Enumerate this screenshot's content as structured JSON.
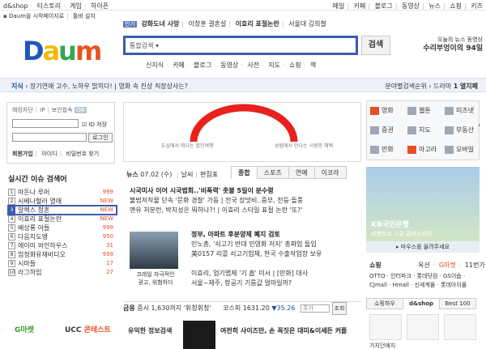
{
  "topbar": {
    "left": [
      "d&shop",
      "티스토리",
      "게임",
      "하이픈"
    ],
    "right": [
      "메일",
      "카페",
      "블로그",
      "동영상",
      "뉴스",
      "쇼핑",
      "키즈"
    ]
  },
  "subtop": {
    "start_page": "Daum을 시작페이지로",
    "install": "툴바 설치"
  },
  "logo": {
    "letters": [
      "D",
      "a",
      "u",
      "m"
    ],
    "colors": [
      "#2058b8",
      "#f5b800",
      "#34a853",
      "#e8541f"
    ]
  },
  "hot": {
    "badge": "인기",
    "items": [
      "강화도녀 사망",
      "이창훈 결혼설",
      "이효리 표절논란",
      "서울대 김희철"
    ]
  },
  "search": {
    "select_label": "통합검색",
    "query": "",
    "button_label": "검색"
  },
  "services": [
    "신지식",
    "카페",
    "블로그",
    "동영상",
    "사전",
    "지도",
    "쇼핑",
    "책"
  ],
  "promo_right": {
    "line1": "오늘의 뉴스 동영상",
    "line2": "수리부엉이의 94일"
  },
  "ticker": {
    "label": "지식",
    "text": "장기연애 고수, 노하우 밝히다! | 영화 속 진상 직장상사는?",
    "right_label": "분야별검색순위",
    "right_item": "드라마",
    "right_rank": "1",
    "right_value": "열지페"
  },
  "login": {
    "opts": [
      "해킹차단",
      "IP",
      "보안접속"
    ],
    "pill": "ON",
    "save": "ID 저장",
    "button": "로그인",
    "links": [
      "회원가입",
      "아이디",
      "비밀번호 찾기"
    ]
  },
  "ranks": {
    "title": "실시간 이슈 검색어",
    "items": [
      {
        "n": "1",
        "label": "마돈나 루머",
        "chg": "999"
      },
      {
        "n": "2",
        "label": "시베나혈러 열애",
        "chg": "NEW"
      },
      {
        "n": "3",
        "label": "알렉스 청혼",
        "chg": "NEW"
      },
      {
        "n": "4",
        "label": "이효리 표절논란",
        "chg": "NEW"
      },
      {
        "n": "5",
        "label": "배상룡 아들",
        "chg": "999"
      },
      {
        "n": "6",
        "label": "다음지도앵",
        "chg": "950"
      },
      {
        "n": "7",
        "label": "에이미 와인하우스",
        "chg": "31"
      },
      {
        "n": "8",
        "label": "엄정화유재비디오",
        "chg": "999"
      },
      {
        "n": "9",
        "label": "시마들",
        "chg": "17"
      },
      {
        "n": "10",
        "label": "라그하임",
        "chg": "27"
      }
    ],
    "highlight_index": 2
  },
  "bottom_left": {
    "gmarket": "G마켓",
    "ucc": "UCC",
    "ucc_em": "콘테스트"
  },
  "banner": {
    "cap_left": "도심에서 떠나는 합인여행",
    "cap_right": "성림에서 만나는 시원한 해택"
  },
  "news": {
    "label": "뉴스",
    "date": "07.02 (수)",
    "weather_label": "날씨",
    "editor": "편집표",
    "tabs": [
      "종합",
      "스포츠",
      "연예",
      "이코라"
    ],
    "active_tab": 0,
    "list1": [
      {
        "text": "시국미사 이어 시국법회..'비폭력' 촛불 5일이 분수령",
        "head": true
      },
      {
        "text": "불법저작물 단속 '문화 경찰' 가동 | 전국 장맛비..중부, 천둥·돌풍",
        "head": false
      },
      {
        "text": "맨유 처분런, 박지성은 뭐하나?! | 이효리 스타일 표절 논란 '또?'",
        "head": false
      }
    ],
    "img_caption1": "코레일 자극적인",
    "img_caption2": "광고, 위험하다",
    "list2": [
      {
        "text": "정부, 아파트 후분양제 폐지 검토",
        "head": true
      },
      {
        "text": "민노총, '쇠고기 반대 민영화 저지' 총파업 돌입",
        "head": false
      },
      {
        "text": "美0157 리콜 쇠고기업체, 한국 수출작업장 보유",
        "head": false
      },
      {
        "text": "",
        "head": false
      },
      {
        "text": "이효리, 업기랩제 '기 흡' 미서 | [만화] 대사",
        "head": false
      },
      {
        "text": "서울~제주, 항공기 기름값 얼마일까?",
        "head": false
      }
    ]
  },
  "stock": {
    "label": "금융",
    "text": "증시 1,630까지 '휘청휘청'",
    "index_label": "코스피",
    "index_value": "1631.20",
    "change": "▼35.26",
    "input_ph": "주가",
    "go": "조회"
  },
  "info": {
    "title": "유익한 정보검색",
    "text": "여전히 사이즈만, 손 꼭짓은 대미&이세든 커플"
  },
  "svc_grid": [
    {
      "label": "영화",
      "color": "#e94e27"
    },
    {
      "label": "웹툰",
      "color": "#a0a8b4"
    },
    {
      "label": "미즈넷",
      "color": "#a0a8b4"
    },
    {
      "label": "증권",
      "color": "#a0a8b4"
    },
    {
      "label": "지도",
      "color": "#a0a8b4"
    },
    {
      "label": "부동산",
      "color": "#a0a8b4"
    },
    {
      "label": "만화",
      "color": "#a0a8b4"
    },
    {
      "label": "아고라",
      "color": "#e94e27"
    },
    {
      "label": "모바일",
      "color": "#a0a8b4"
    }
  ],
  "ad": {
    "brand": "KB국민은행",
    "sub": "비행학교 스쿨 클래스하다",
    "foot": "마우스를 올려주세요"
  },
  "shop": {
    "title": "쇼핑",
    "right": [
      "옥션",
      "G마켓",
      "11번가"
    ],
    "links": "OTTO · 인터파크 · 롯데닷컴 · GS이숍 · CJmall · Hmall · 신세계몰 · 롯데아이몰",
    "tabs": [
      "쇼핑하우",
      "d&shop",
      "Best 100"
    ],
    "active_tab": 1,
    "cap": "가지던에지"
  }
}
